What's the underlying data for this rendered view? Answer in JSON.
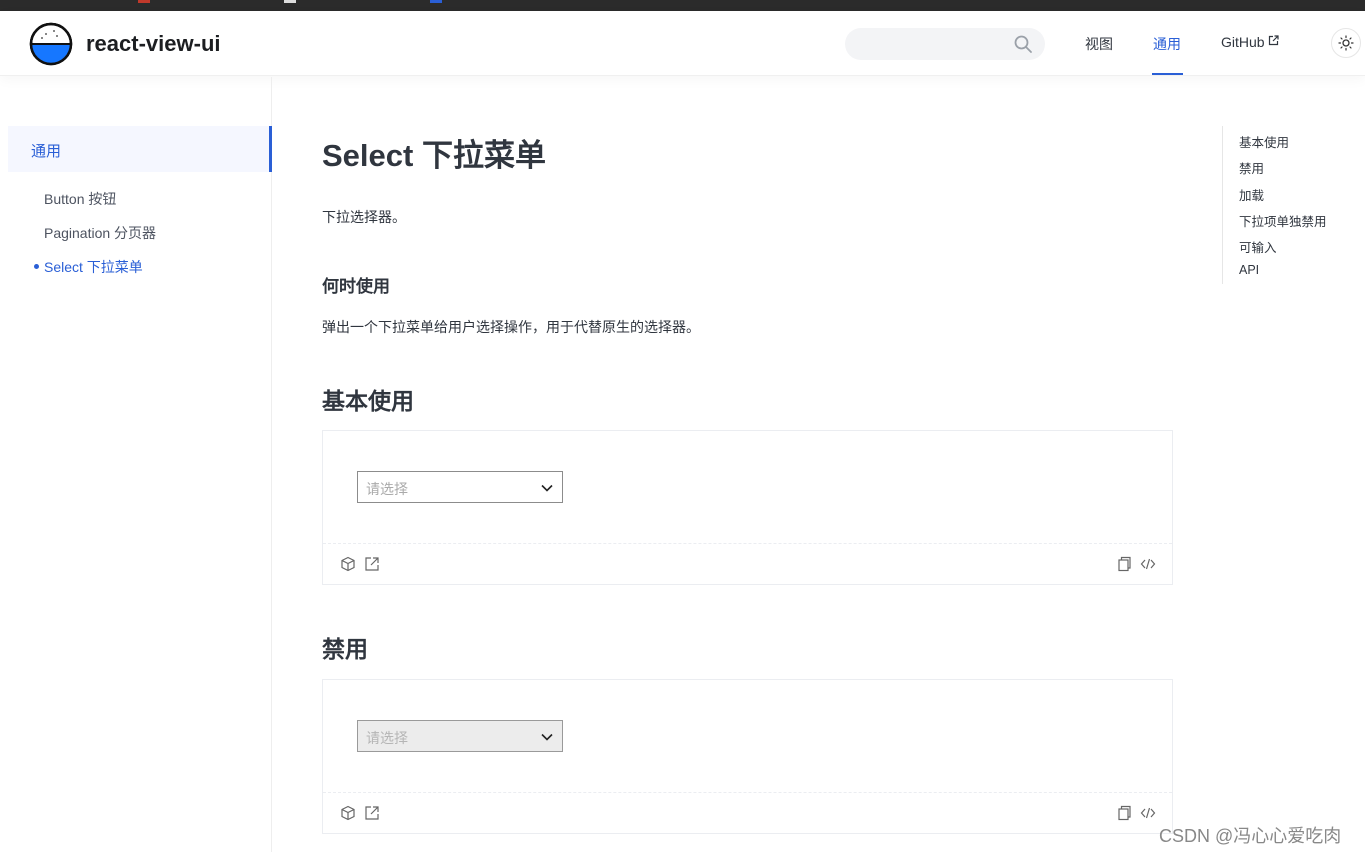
{
  "colors": {
    "accent": "#2a5fd6",
    "text": "#30363f",
    "border": "#ebedf1"
  },
  "header": {
    "brand": "react-view-ui",
    "search_placeholder": "",
    "nav": [
      {
        "label": "视图",
        "active": false
      },
      {
        "label": "通用",
        "active": true
      },
      {
        "label": "GitHub",
        "active": false,
        "icon": "external-link-icon"
      }
    ],
    "theme_icon": "sun-icon"
  },
  "sidebar": {
    "group": "通用",
    "items": [
      {
        "label": "Button 按钮",
        "active": false
      },
      {
        "label": "Pagination 分页器",
        "active": false
      },
      {
        "label": "Select 下拉菜单",
        "active": true
      }
    ]
  },
  "main": {
    "title": "Select 下拉菜单",
    "intro": "下拉选择器。",
    "when_heading": "何时使用",
    "when_text": "弹出一个下拉菜单给用户选择操作，用于代替原生的选择器。",
    "sections": [
      {
        "heading": "基本使用",
        "select_placeholder": "请选择",
        "disabled": false
      },
      {
        "heading": "禁用",
        "select_placeholder": "请选择",
        "disabled": true
      }
    ],
    "demo_icons": [
      "codesandbox-icon",
      "open-external-icon",
      "copy-icon",
      "code-icon"
    ]
  },
  "toc": [
    "基本使用",
    "禁用",
    "加载",
    "下拉项单独禁用",
    "可输入",
    "API"
  ],
  "watermark": "CSDN @冯心心爱吃肉"
}
